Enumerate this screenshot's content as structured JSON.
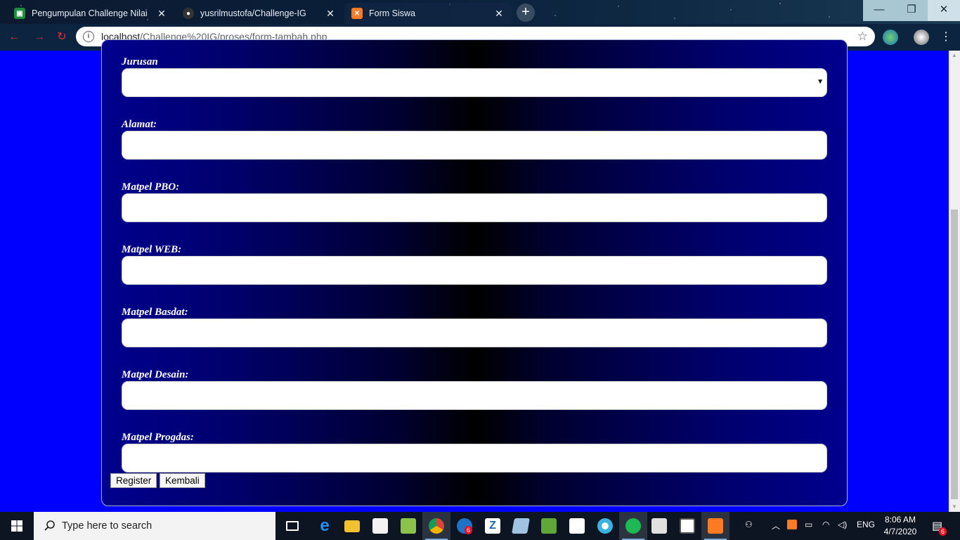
{
  "browser": {
    "tabs": [
      {
        "title": "Pengumpulan Challenge Nilai",
        "active": false,
        "favicon": "classroom-icon",
        "close": "✕"
      },
      {
        "title": "yusrilmustofa/Challenge-IG",
        "active": false,
        "favicon": "github-icon",
        "close": "✕"
      },
      {
        "title": "Form Siswa",
        "active": true,
        "favicon": "xampp-icon",
        "close": "✕"
      }
    ],
    "new_tab": "+",
    "window_controls": {
      "minimize": "—",
      "restore": "❐",
      "close": "✕"
    },
    "url_host": "localhost",
    "url_path": "/Challenge%20IG/proses/form-tambah.php"
  },
  "form": {
    "fields": [
      {
        "label": "Jurusan",
        "type": "select",
        "value": ""
      },
      {
        "label": "Alamat:",
        "type": "text",
        "value": ""
      },
      {
        "label": "Matpel PBO:",
        "type": "text",
        "value": ""
      },
      {
        "label": "Matpel WEB:",
        "type": "text",
        "value": ""
      },
      {
        "label": "Matpel Basdat:",
        "type": "text",
        "value": ""
      },
      {
        "label": "Matpel Desain:",
        "type": "text",
        "value": ""
      },
      {
        "label": "Matpel Progdas:",
        "type": "text",
        "value": ""
      }
    ],
    "register_label": "Register",
    "back_label": "Kembali"
  },
  "taskbar": {
    "search_placeholder": "Type here to search",
    "apps": [
      "task-view",
      "edge",
      "file-explorer",
      "visual-studio",
      "notepad-plus",
      "chrome",
      "store-badge",
      "filezilla",
      "sticky",
      "sublime",
      "ms-store",
      "camera",
      "spotify",
      "media",
      "video",
      "xampp"
    ],
    "badges": {
      "store_count": "6",
      "notification_count": "6"
    },
    "language": "ENG",
    "time": "8:06 AM",
    "date": "4/7/2020"
  }
}
